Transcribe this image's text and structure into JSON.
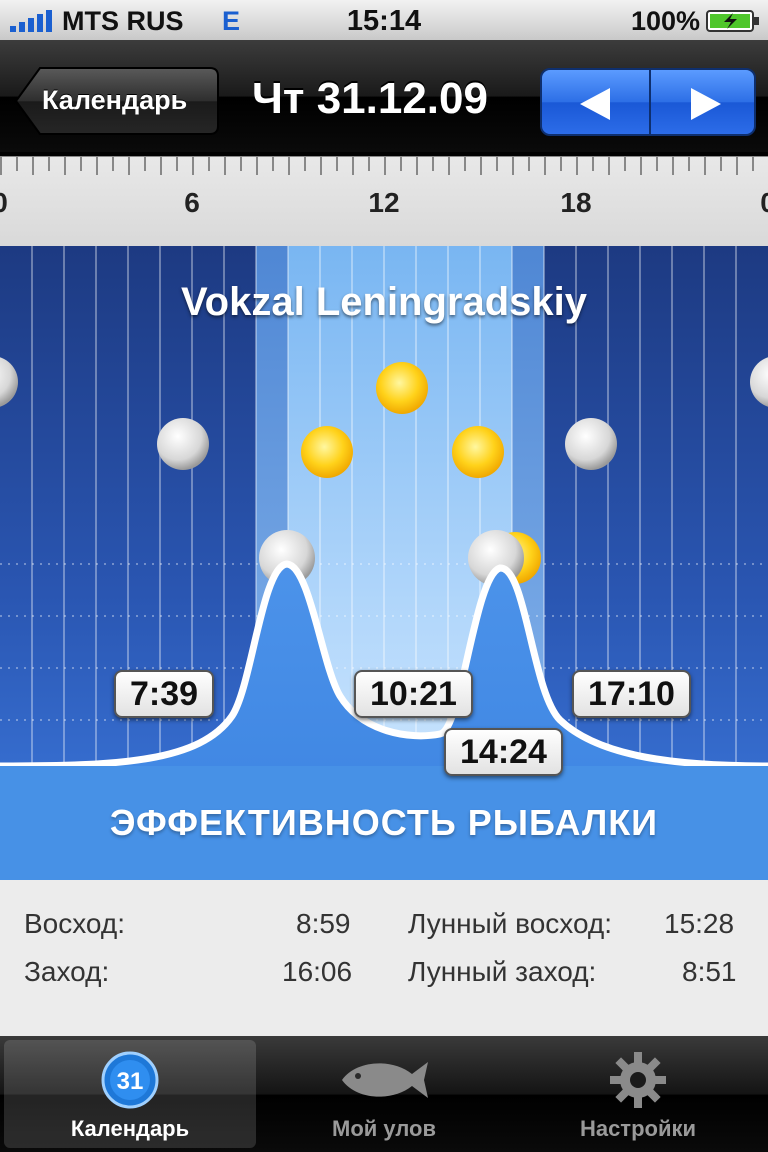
{
  "status_bar": {
    "carrier": "MTS RUS",
    "network": "E",
    "time": "15:14",
    "battery": "100%"
  },
  "nav": {
    "back_label": "Календарь",
    "title": "Чт 31.12.09",
    "prev_icon": "triangle-left-icon",
    "next_icon": "triangle-right-icon"
  },
  "ruler": {
    "labels": [
      "0",
      "6",
      "12",
      "18",
      "0"
    ]
  },
  "chart": {
    "place": "Vokzal Leningradskiy",
    "effect_label": "ЭФФЕКТИВНОСТЬ РЫБАЛКИ",
    "times": [
      "7:39",
      "10:21",
      "14:24",
      "17:10"
    ],
    "highlight_color": "#bfe0ff"
  },
  "info": {
    "sunrise_label": "Восход:",
    "sunrise": "8:59",
    "sunset_label": "Заход:",
    "sunset": "16:06",
    "moonrise_label": "Лунный восход:",
    "moonrise": "15:28",
    "moonset_label": "Лунный заход:",
    "moonset": "8:51"
  },
  "tabs": [
    {
      "label": "Календарь",
      "icon": "calendar-31-icon",
      "badge": "31"
    },
    {
      "label": "Мой улов",
      "icon": "fish-icon"
    },
    {
      "label": "Настройки",
      "icon": "gear-icon"
    }
  ]
}
